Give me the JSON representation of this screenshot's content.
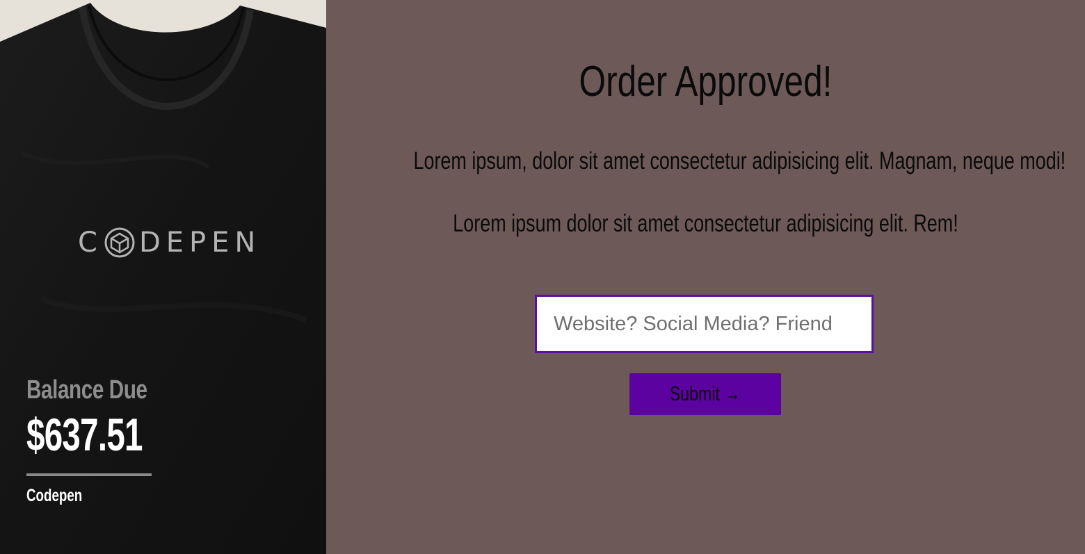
{
  "product": {
    "logo_text": "CODEPEN",
    "balance_label": "Balance Due",
    "balance_amount": "$637.51",
    "brand": "Codepen"
  },
  "confirmation": {
    "title": "Order Approved!",
    "paragraph_1": "Lorem ipsum, dolor sit amet consectetur adipisicing elit. Magnam, neque modi!",
    "paragraph_2": "Lorem ipsum dolor sit amet consectetur adipisicing elit. Rem!",
    "referral_placeholder": "Website? Social Media? Friend",
    "referral_value": "",
    "submit_label": "Submit →"
  },
  "colors": {
    "panel_background": "#6e5959",
    "shirt": "#151515",
    "accent": "#5c02a0",
    "input_border": "#5b0fa3",
    "balance_label": "#8d8d8d"
  },
  "icons": {
    "logo": "codepen-cube-icon",
    "arrow": "right-arrow"
  }
}
